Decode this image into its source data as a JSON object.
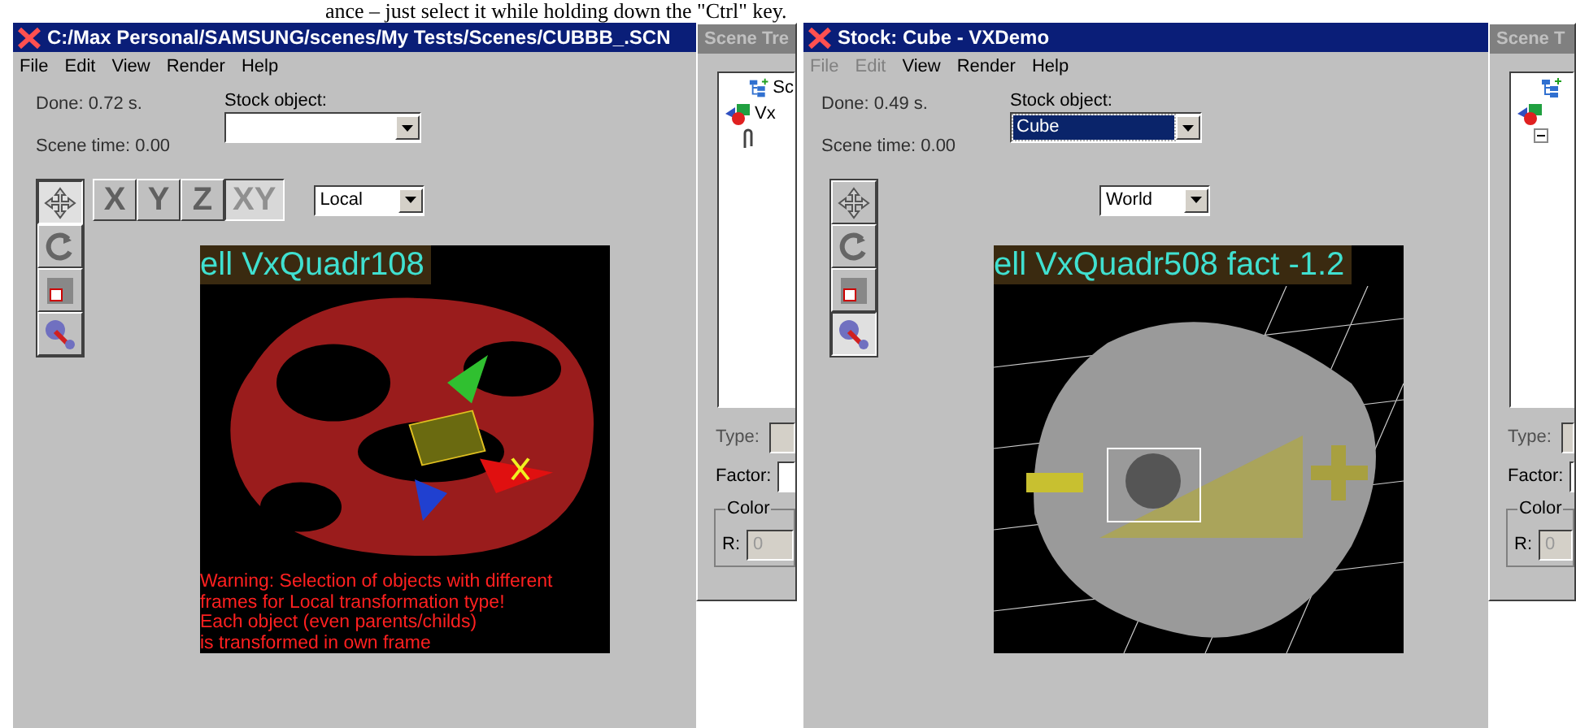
{
  "document_text": "ance – just select it while holding down the \"Ctrl\" key.",
  "windows": [
    {
      "title": "C:/Max Personal/SAMSUNG/scenes/My Tests/Scenes/CUBBB_.SCN",
      "menu": [
        {
          "label": "File",
          "disabled": false
        },
        {
          "label": "Edit",
          "disabled": false
        },
        {
          "label": "View",
          "disabled": false
        },
        {
          "label": "Render",
          "disabled": false
        },
        {
          "label": "Help",
          "disabled": false
        }
      ],
      "done": "Done: 0.72 s.",
      "scene_time": "Scene time: 0.00",
      "stock_label": "Stock object:",
      "stock_focused": false,
      "tools": [
        {
          "kind": "move",
          "selected": true
        },
        {
          "kind": "rotate",
          "selected": false
        },
        {
          "kind": "scale",
          "selected": false
        },
        {
          "kind": "material",
          "selected": false
        }
      ],
      "axis_buttons": [
        {
          "label": "X",
          "selected": false
        },
        {
          "label": "Y",
          "selected": false
        },
        {
          "label": "Z",
          "selected": false
        },
        {
          "label": "XY",
          "selected": true
        }
      ],
      "frame": "Local",
      "viewport": {
        "kind": "torus",
        "caption": "ell VxQuadr108",
        "warning": [
          "Warning: Selection of objects with different",
          "frames for Local transformation type!",
          "Each object (even parents/childs)",
          "is transformed in own frame"
        ]
      },
      "scene_tree": {
        "title": "Scene Tre",
        "items": [
          {
            "kind": "scene",
            "label": "Sc"
          },
          {
            "kind": "object",
            "label": "Vx"
          },
          {
            "kind": "clip"
          }
        ],
        "type_label": "Type:",
        "factor_label": "Factor:",
        "color_label": "Color",
        "r_label": "R:",
        "r_value": "0"
      }
    },
    {
      "title": "Stock: Cube - VXDemo",
      "menu": [
        {
          "label": "File",
          "disabled": true
        },
        {
          "label": "Edit",
          "disabled": true
        },
        {
          "label": "View",
          "disabled": false
        },
        {
          "label": "Render",
          "disabled": false
        },
        {
          "label": "Help",
          "disabled": false
        }
      ],
      "done": "Done: 0.49 s.",
      "scene_time": "Scene time: 0.00",
      "stock_label": "Stock object:",
      "stock_value": "Cube",
      "stock_focused": true,
      "tools": [
        {
          "kind": "move",
          "selected": false
        },
        {
          "kind": "rotate",
          "selected": false
        },
        {
          "kind": "scale",
          "selected": false
        },
        {
          "kind": "material",
          "selected": true
        }
      ],
      "frame": "World",
      "viewport": {
        "kind": "cube",
        "caption": "ell VxQuadr508  fact -1.2"
      },
      "scene_tree": {
        "title": "Scene T",
        "items": [
          {
            "kind": "scene"
          },
          {
            "kind": "object"
          },
          {
            "kind": "branch"
          }
        ],
        "type_label": "Type:",
        "factor_label": "Factor:",
        "color_label": "Color",
        "r_label": "R:",
        "r_value": "0"
      }
    }
  ]
}
